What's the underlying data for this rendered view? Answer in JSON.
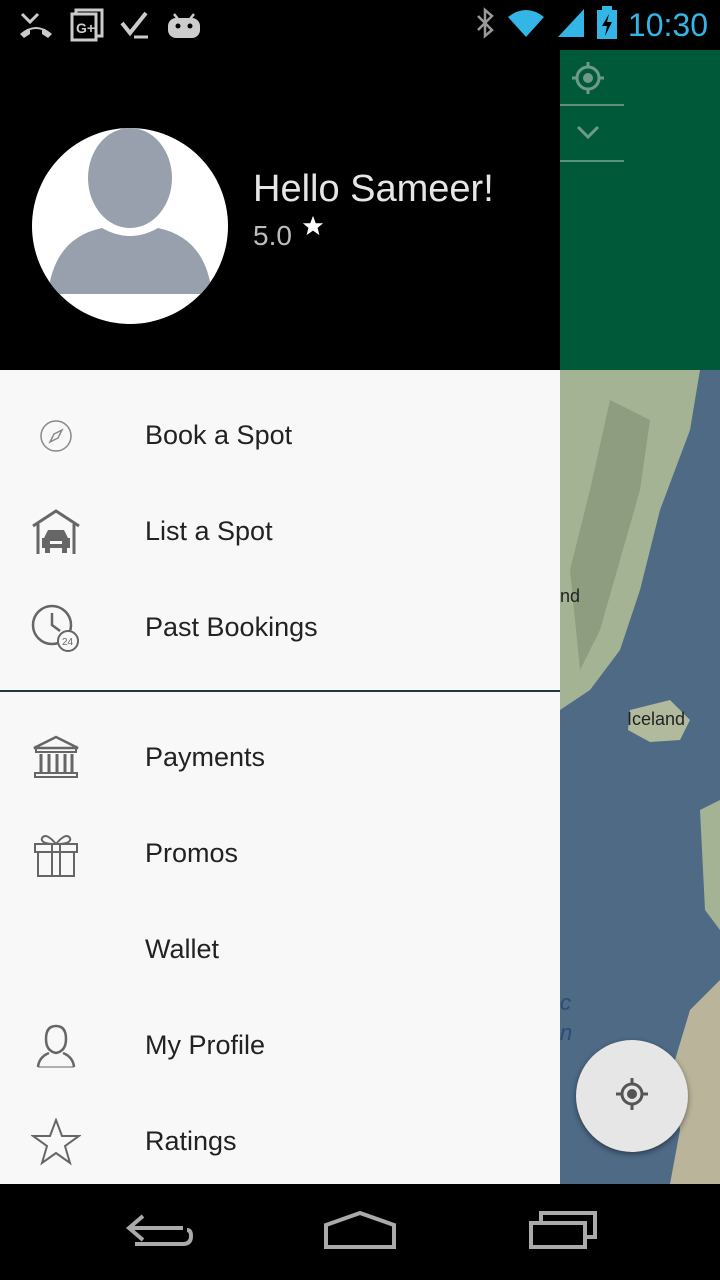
{
  "status_bar": {
    "time": "10:30",
    "left_icons": [
      "missed-call-icon",
      "google-plus-icon",
      "checkmark-task-icon",
      "android-icon"
    ],
    "right_icons": [
      "bluetooth-icon",
      "wifi-icon",
      "signal-icon",
      "battery-charging-icon"
    ],
    "accent_color": "#33b5e5"
  },
  "background_app": {
    "header_color": "#005a3a",
    "map_labels": {
      "greenland_fragment": "nd",
      "iceland": "Iceland",
      "ocean_fragment_1": "c",
      "ocean_fragment_2": "n"
    },
    "header_icons": [
      "locate-icon",
      "chevron-down-icon"
    ],
    "fab_icon": "my-location-icon"
  },
  "drawer": {
    "greeting": "Hello Sameer!",
    "rating": "5.0",
    "rating_icon": "star-icon",
    "menu_primary": [
      {
        "label": "Book a Spot",
        "icon": "compass-icon"
      },
      {
        "label": "List a Spot",
        "icon": "garage-icon"
      },
      {
        "label": "Past Bookings",
        "icon": "clock-24-icon"
      }
    ],
    "menu_secondary": [
      {
        "label": "Payments",
        "icon": "bank-icon"
      },
      {
        "label": "Promos",
        "icon": "gift-icon"
      },
      {
        "label": "Wallet",
        "icon": ""
      },
      {
        "label": "My Profile",
        "icon": "user-icon"
      },
      {
        "label": "Ratings",
        "icon": "star-outline-icon"
      }
    ]
  },
  "nav_bar": {
    "buttons": [
      "back-icon",
      "home-icon",
      "recents-icon"
    ]
  }
}
